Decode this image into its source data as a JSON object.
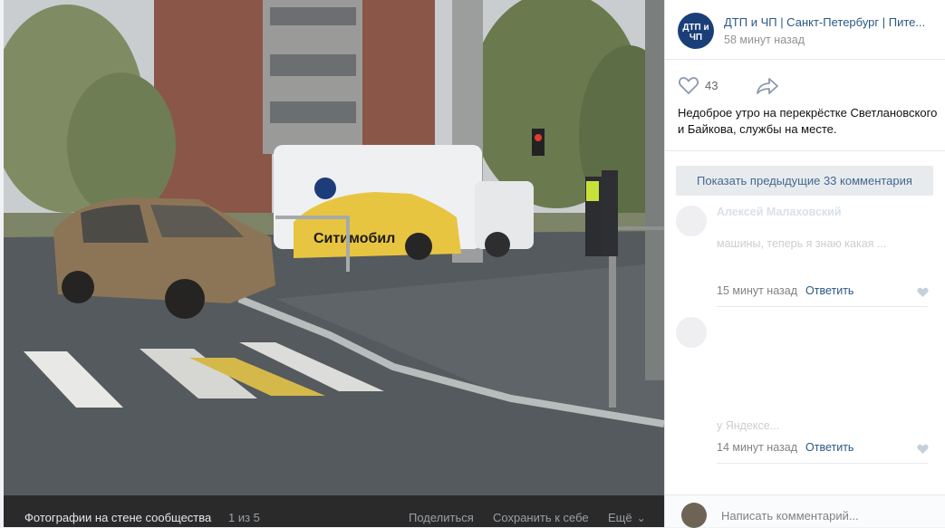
{
  "footer": {
    "title": "Фотографии на стене сообщества",
    "counter": "1 из 5",
    "share": "Поделиться",
    "save": "Сохранить к себе",
    "more": "Ещё"
  },
  "photo": {
    "taxi_sign": "Ситимобил"
  },
  "group": {
    "avatar_text": "ДТП и ЧП",
    "name": "ДТП и ЧП | Санкт-Петербург | Пите...",
    "time": "58 минут назад"
  },
  "post": {
    "likes": "43",
    "text": "Недоброе утро на перекрёстке Светлановского и Байкова, службы на месте."
  },
  "comments": {
    "show_previous": "Показать предыдущие 33 комментария",
    "items": [
      {
        "author": "Алексей Малаховский",
        "text": "машины, теперь я знаю какая ...",
        "time": "15 минут назад",
        "reply": "Ответить"
      },
      {
        "author": "",
        "text": "у Яндексе...",
        "time": "14 минут назад",
        "reply": "Ответить"
      }
    ],
    "input_placeholder": "Написать комментарий..."
  },
  "colors": {
    "link": "#2a5885",
    "footer_bg": "#2a2a2b",
    "button_bg": "#e8ebee"
  }
}
